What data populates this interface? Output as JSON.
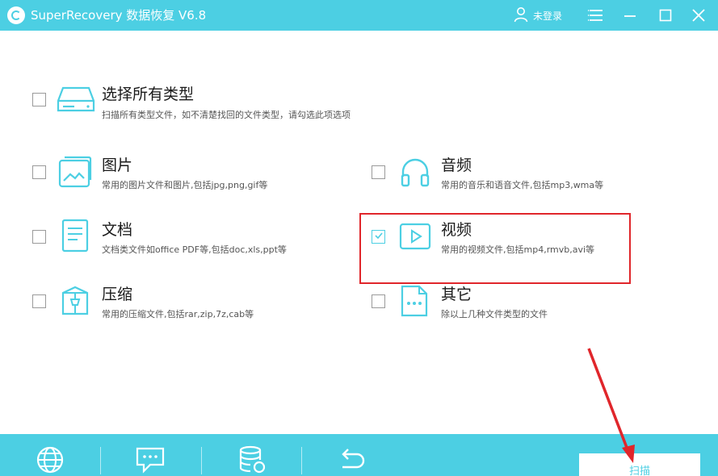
{
  "titlebar": {
    "app_title": "SuperRecovery 数据恢复 V6.8",
    "user_label": "未登录",
    "icons": [
      "app-logo-icon",
      "user-icon",
      "menu-icon",
      "minimize-icon",
      "maximize-icon",
      "close-icon"
    ]
  },
  "options": {
    "all": {
      "title": "选择所有类型",
      "desc": "扫描所有类型文件，如不清楚找回的文件类型，请勾选此项选项",
      "checked": false,
      "icon": "disk-drive-icon"
    },
    "image": {
      "title": "图片",
      "desc": "常用的图片文件和图片,包括jpg,png,gif等",
      "checked": false,
      "icon": "image-icon"
    },
    "audio": {
      "title": "音频",
      "desc": "常用的音乐和语音文件,包括mp3,wma等",
      "checked": false,
      "icon": "headphones-icon"
    },
    "doc": {
      "title": "文档",
      "desc": "文档类文件如office PDF等,包括doc,xls,ppt等",
      "checked": false,
      "icon": "document-icon"
    },
    "video": {
      "title": "视频",
      "desc": "常用的视频文件,包括mp4,rmvb,avi等",
      "checked": true,
      "icon": "video-play-icon"
    },
    "archive": {
      "title": "压缩",
      "desc": "常用的压缩文件,包括rar,zip,7z,cab等",
      "checked": false,
      "icon": "archive-icon"
    },
    "other": {
      "title": "其它",
      "desc": "除以上几种文件类型的文件",
      "checked": false,
      "icon": "other-file-icon"
    }
  },
  "bottombar": {
    "icons": [
      "globe-icon",
      "chat-icon",
      "database-icon",
      "back-icon"
    ],
    "scan_label": "扫描"
  },
  "colors": {
    "accent": "#4ccfe3",
    "highlight": "#e0262b"
  }
}
